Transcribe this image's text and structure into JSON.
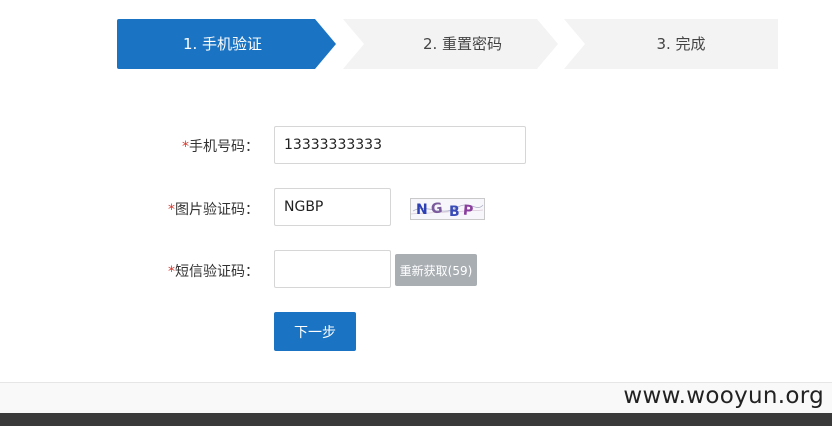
{
  "steps": [
    {
      "label": "1. 手机验证",
      "active": true
    },
    {
      "label": "2. 重置密码",
      "active": false
    },
    {
      "label": "3. 完成",
      "active": false
    }
  ],
  "form": {
    "required_mark": "*",
    "phone": {
      "label": "手机号码：",
      "value": "13333333333"
    },
    "image_code": {
      "label": "图片验证码：",
      "value": "NGBP",
      "captcha_text": "NGBP"
    },
    "sms_code": {
      "label": "短信验证码：",
      "value": "",
      "send_button": "重新获取(59)"
    },
    "next_button": "下一步"
  },
  "footer": {
    "watermark": "www.wooyun.org"
  },
  "colors": {
    "accent": "#1a73c3",
    "inactive_step": "#f3f3f3",
    "required": "#d9372b",
    "disabled_button": "#a9aeb3"
  }
}
